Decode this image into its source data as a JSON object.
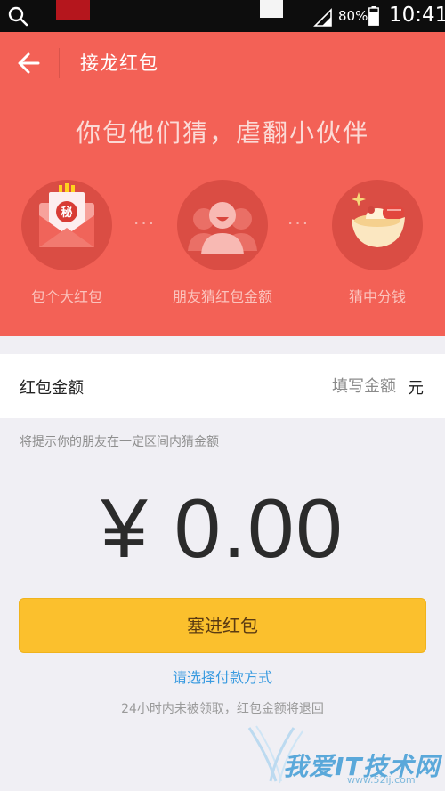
{
  "status_bar": {
    "battery_percent": "80%",
    "time": "10:41",
    "icons": [
      "search-icon",
      "signal-icon",
      "battery-icon"
    ]
  },
  "nav": {
    "back_icon": "arrow-left-icon",
    "title": "接龙红包"
  },
  "banner": {
    "slogan": "你包他们猜，虐翻小伙伴",
    "steps": [
      {
        "label": "包个大红包",
        "icon": "red-envelope-secret-icon",
        "badge": "秘"
      },
      {
        "label": "朋友猜红包金额",
        "icon": "friends-guess-icon"
      },
      {
        "label": "猜中分钱",
        "icon": "gold-ingot-icon"
      }
    ],
    "separator": "···"
  },
  "amount_field": {
    "label": "红包金额",
    "placeholder": "填写金额",
    "value": "",
    "unit": "元"
  },
  "hint": "将提示你的朋友在一定区间内猜金额",
  "total_display": "¥ 0.00",
  "submit_label": "塞进红包",
  "pay_method_link": "请选择付款方式",
  "notice": "24小时内未被领取，红包金额将退回",
  "watermark": {
    "text": "我爱IT技术网",
    "url": "www.52ij.com"
  },
  "colors": {
    "header_red": "#f36156",
    "circle_red": "#da4d44",
    "button_yellow": "#fbc02d",
    "link_blue": "#3a9be0"
  }
}
